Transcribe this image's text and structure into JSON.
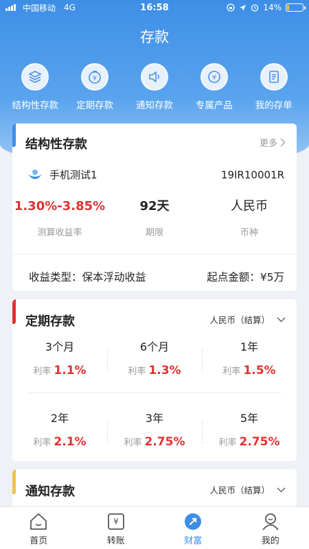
{
  "status_bar": {
    "carrier": "中国移动",
    "network": "4G",
    "time": "16:58",
    "battery": "14%",
    "battery_level": 0.14
  },
  "header": {
    "title": "存款"
  },
  "quick_nav": [
    {
      "label": "结构性存款",
      "icon": "layers-icon"
    },
    {
      "label": "定期存款",
      "icon": "timer-yuan-icon"
    },
    {
      "label": "通知存款",
      "icon": "speaker-icon"
    },
    {
      "label": "专属产品",
      "icon": "yuan-circle-icon"
    },
    {
      "label": "我的存单",
      "icon": "document-icon"
    }
  ],
  "structured_deposit": {
    "title": "结构性存款",
    "more": "更多",
    "product_name": "手机测试1",
    "product_code": "19IR10001R",
    "stats": [
      {
        "value": "1.30%-3.85%",
        "label": "测算收益率"
      },
      {
        "value": "92天",
        "label": "期限"
      },
      {
        "value": "人民币",
        "label": "币种"
      }
    ],
    "income_type": "收益类型：保本浮动收益",
    "min_amount": "起点金额：¥5万",
    "accent_color": "#3d8ee6"
  },
  "fixed_deposit": {
    "title": "定期存款",
    "currency": "人民币（结算）",
    "rate_label": "利率",
    "accent_color": "#e0322e",
    "rates": [
      {
        "term": "3个月",
        "rate": "1.1%"
      },
      {
        "term": "6个月",
        "rate": "1.3%"
      },
      {
        "term": "1年",
        "rate": "1.5%"
      },
      {
        "term": "2年",
        "rate": "2.1%"
      },
      {
        "term": "3年",
        "rate": "2.75%"
      },
      {
        "term": "5年",
        "rate": "2.75%"
      }
    ]
  },
  "notice_deposit": {
    "title": "通知存款",
    "currency": "人民币（结算）",
    "accent_color": "#f2c14e"
  },
  "tab_bar": [
    {
      "label": "首页",
      "icon": "home-icon"
    },
    {
      "label": "转账",
      "icon": "transfer-icon"
    },
    {
      "label": "财富",
      "icon": "wealth-icon",
      "active": true
    },
    {
      "label": "我的",
      "icon": "user-icon"
    }
  ],
  "colors": {
    "primary": "#3d8ee6",
    "highlight_red": "#e0322e",
    "notice_yellow": "#f2c14e"
  }
}
